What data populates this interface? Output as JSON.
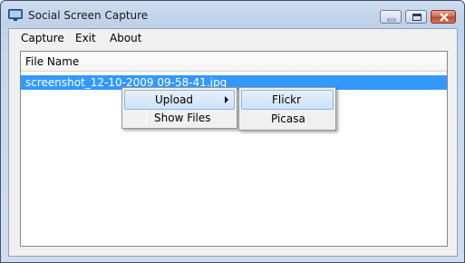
{
  "window": {
    "title": "Social Screen Capture"
  },
  "menubar": {
    "items": [
      "Capture",
      "Exit",
      "About"
    ]
  },
  "listview": {
    "columns": [
      "File Name"
    ],
    "rows": [
      "screenshot_12-10-2009 09-58-41.jpg"
    ]
  },
  "context_menu": {
    "items": [
      "Upload",
      "Show Files"
    ]
  },
  "submenu": {
    "items": [
      "Flickr",
      "Picasa"
    ]
  },
  "colors": {
    "selection": "#3399ff",
    "close_button": "#c0442a"
  },
  "icons": [
    "app-icon",
    "minimize-icon",
    "maximize-icon",
    "close-icon",
    "submenu-arrow-icon"
  ]
}
